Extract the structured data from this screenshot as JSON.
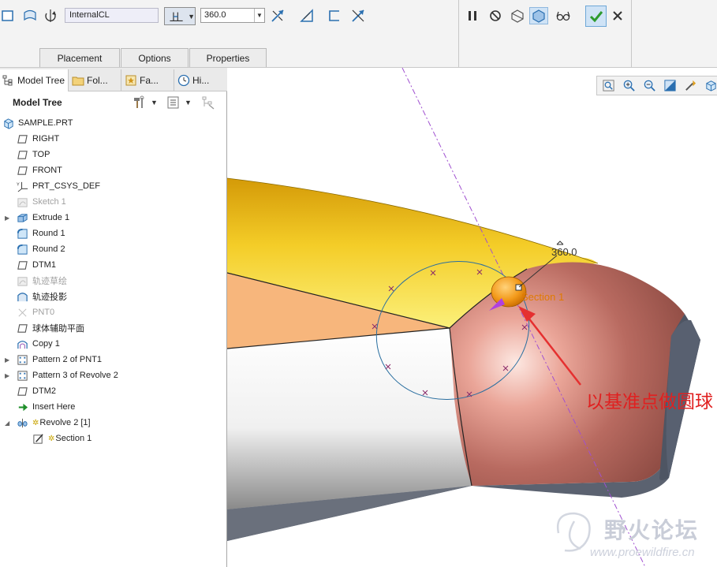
{
  "dashboard": {
    "axis_reference": "InternalCL",
    "angle_value": "360.0",
    "tabs": [
      "Placement",
      "Options",
      "Properties"
    ],
    "colors": {
      "ok_green": "#2e9b2e",
      "toolbar_bg": "#f3f3f3"
    }
  },
  "navigator": {
    "tabs": [
      "Model Tree",
      "Fol...",
      "Fa...",
      "Hi..."
    ],
    "tree_title": "Model Tree"
  },
  "model_tree": [
    {
      "label": "SAMPLE.PRT",
      "icon": "part-icon",
      "state": "normal"
    },
    {
      "label": "RIGHT",
      "icon": "datum-plane-icon",
      "state": "normal"
    },
    {
      "label": "TOP",
      "icon": "datum-plane-icon",
      "state": "normal"
    },
    {
      "label": "FRONT",
      "icon": "datum-plane-icon",
      "state": "normal"
    },
    {
      "label": "PRT_CSYS_DEF",
      "icon": "csys-icon",
      "state": "normal"
    },
    {
      "label": "Sketch 1",
      "icon": "sketch-icon",
      "state": "suppressed"
    },
    {
      "label": "Extrude 1",
      "icon": "extrude-icon",
      "state": "normal",
      "expandable": true
    },
    {
      "label": "Round 1",
      "icon": "round-icon",
      "state": "normal"
    },
    {
      "label": "Round 2",
      "icon": "round-icon",
      "state": "normal"
    },
    {
      "label": "DTM1",
      "icon": "datum-plane-icon",
      "state": "normal"
    },
    {
      "label": "轨迹草绘",
      "icon": "sketch-icon",
      "state": "suppressed"
    },
    {
      "label": "轨迹投影",
      "icon": "projected-curve-icon",
      "state": "normal"
    },
    {
      "label": "PNT0",
      "icon": "datum-point-icon",
      "state": "suppressed"
    },
    {
      "label": "球体辅助平面",
      "icon": "datum-plane-icon",
      "state": "normal"
    },
    {
      "label": "Copy 1",
      "icon": "copy-icon",
      "state": "normal"
    },
    {
      "label": "Pattern 2 of PNT1",
      "icon": "pattern-icon",
      "state": "normal",
      "expandable": true
    },
    {
      "label": "Pattern 3 of Revolve 2",
      "icon": "pattern-icon",
      "state": "normal",
      "expandable": true
    },
    {
      "label": "DTM2",
      "icon": "datum-plane-icon",
      "state": "normal"
    },
    {
      "label": "Insert Here",
      "icon": "insert-arrow-icon",
      "state": "normal"
    },
    {
      "label": "Revolve 2 [1]",
      "icon": "revolve-icon",
      "state": "active",
      "expanded": true
    },
    {
      "label": "Section 1",
      "icon": "section-sketch-icon",
      "state": "active"
    }
  ],
  "viewport": {
    "dimension_value": "360.0",
    "section_label": "Section 1",
    "annotation": "以基准点做圆球",
    "watermark_title": "野火论坛",
    "watermark_url": "www.proewildfire.cn",
    "colors": {
      "body_top": "#f2c419",
      "round_surface": "#b86a60",
      "dashed_axis": "#a050d0",
      "annotation_red": "#e02020"
    }
  }
}
